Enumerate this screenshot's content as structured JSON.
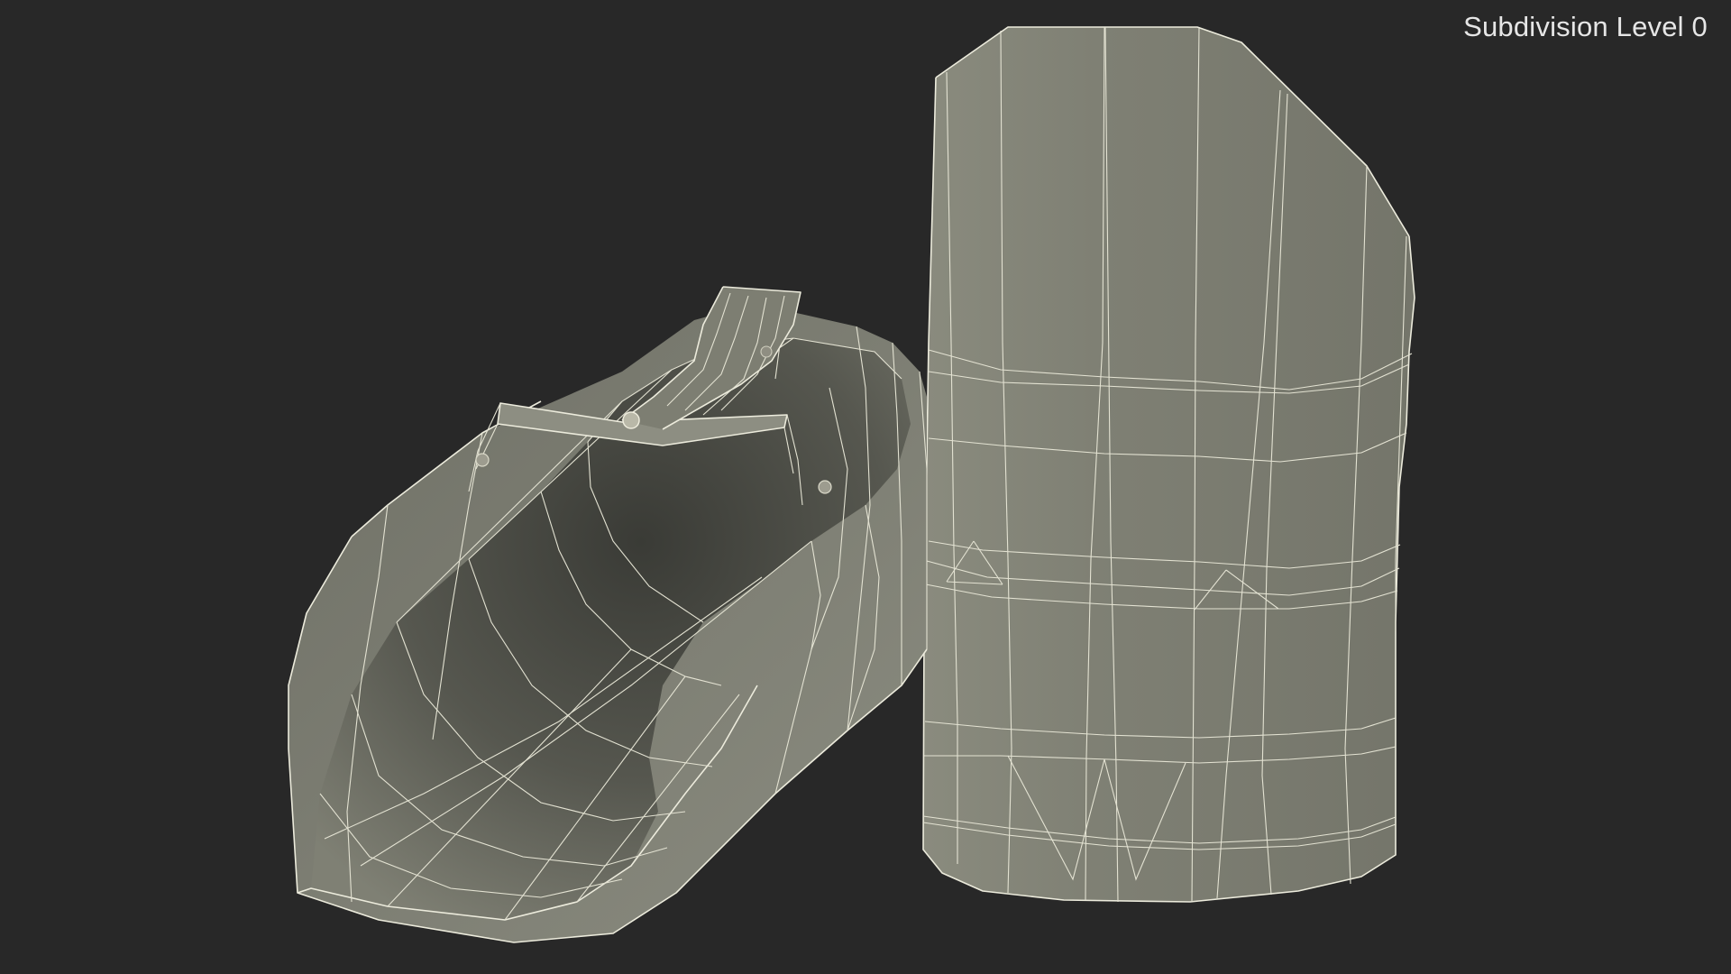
{
  "viewport": {
    "overlay_label": "Subdivision Level 0",
    "background_color": "#282828"
  },
  "scene": {
    "objects": [
      {
        "name": "scoop",
        "description_icon": "scoop-wireframe"
      },
      {
        "name": "canister",
        "description_icon": "canister-wireframe"
      }
    ],
    "colors": {
      "mesh_surface": "#7c7d70",
      "mesh_shadow": "#4a4b44",
      "wire": "#ecebdc"
    }
  }
}
